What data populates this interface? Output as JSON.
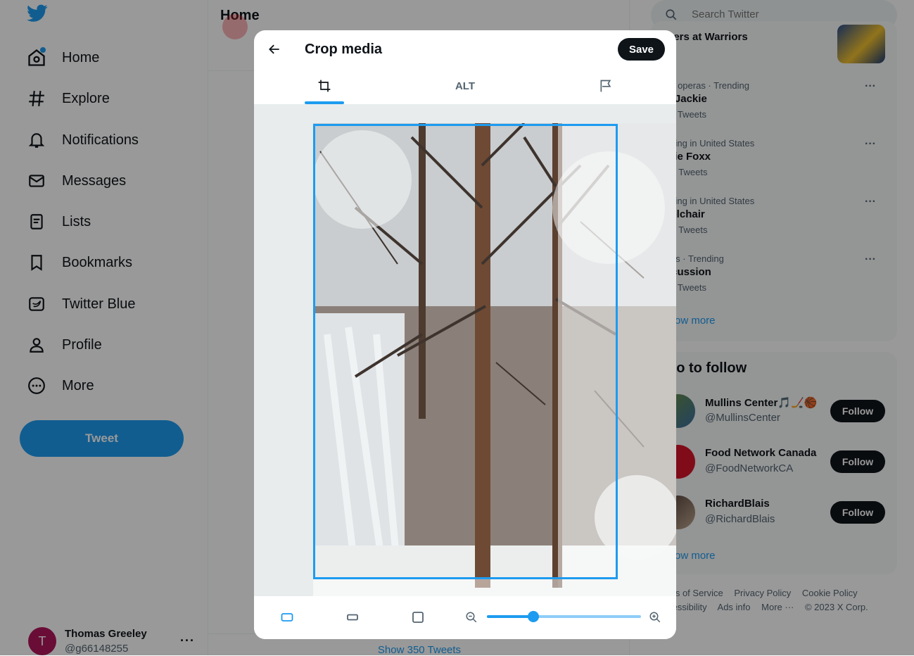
{
  "sidebar": {
    "nav": [
      {
        "label": "Home",
        "icon": "home-icon"
      },
      {
        "label": "Explore",
        "icon": "hashtag-icon"
      },
      {
        "label": "Notifications",
        "icon": "bell-icon"
      },
      {
        "label": "Messages",
        "icon": "envelope-icon"
      },
      {
        "label": "Lists",
        "icon": "list-icon"
      },
      {
        "label": "Bookmarks",
        "icon": "bookmark-icon"
      },
      {
        "label": "Twitter Blue",
        "icon": "twitter-blue-icon"
      },
      {
        "label": "Profile",
        "icon": "person-icon"
      },
      {
        "label": "More",
        "icon": "more-circle-icon"
      }
    ],
    "tweet_label": "Tweet",
    "account": {
      "name": "Thomas Greeley",
      "handle": "@g66148255",
      "avatar_letter": "T"
    }
  },
  "center": {
    "title": "Home",
    "show_tweets": "Show 350 Tweets"
  },
  "right": {
    "search_placeholder": "Search Twitter",
    "top_trend": "kers at Warriors",
    "trends": [
      {
        "meta": "ap operas · Trending",
        "name": "P Jackie",
        "count": "77 Tweets"
      },
      {
        "meta": "nding in United States",
        "name": "mie Foxx",
        "count": "8K Tweets"
      },
      {
        "meta": "nding in United States",
        "name": "eelchair",
        "count": "6K Tweets"
      },
      {
        "meta": "orts · Trending",
        "name": "ncussion",
        "count": "04 Tweets"
      }
    ],
    "trends_show_more": "ow more",
    "who_to_follow": "ho to follow",
    "follow": [
      {
        "name": "Mullins Center🎵🏒🏀",
        "handle": "@MullinsCenter",
        "button": "Follow"
      },
      {
        "name": "Food Network Canada",
        "handle": "@FoodNetworkCA",
        "button": "Follow"
      },
      {
        "name": "RichardBlais",
        "handle": "@RichardBlais",
        "button": "Follow"
      }
    ],
    "follow_show_more": "ow more",
    "footer": {
      "line1": [
        "ms of Service",
        "Privacy Policy",
        "Cookie Policy"
      ],
      "line2": [
        "cessibility",
        "Ads info",
        "More ···",
        "© 2023 X Corp."
      ]
    }
  },
  "modal": {
    "title": "Crop media",
    "save_label": "Save",
    "tabs": {
      "crop_icon": "crop-icon",
      "alt_label": "ALT",
      "flag_icon": "flag-icon"
    },
    "zoom": {
      "value": 0.3
    }
  },
  "colors": {
    "accent": "#1d9bf0",
    "dark": "#0f1419",
    "muted": "#536471"
  }
}
